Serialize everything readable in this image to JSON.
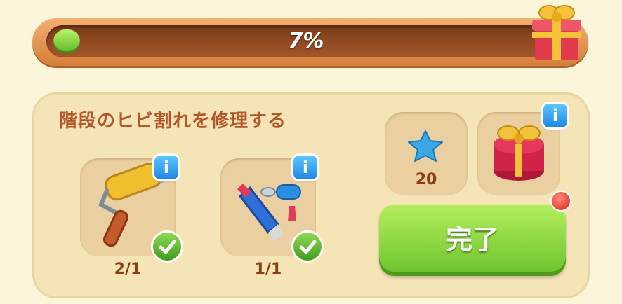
{
  "progress": {
    "label": "7%",
    "value": 0.07
  },
  "task": {
    "title": "階段のヒビ割れを修理する"
  },
  "items": [
    {
      "icon": "paint-roller-icon",
      "count": "2/1",
      "completed": true
    },
    {
      "icon": "glue-tube-icon",
      "count": "1/1",
      "completed": true
    }
  ],
  "rewards": {
    "stars": {
      "icon": "blue-star-icon",
      "amount": "20"
    },
    "gift": {
      "icon": "gift-box-icon"
    }
  },
  "info_label": "i",
  "complete_button": {
    "label": "完了"
  },
  "colors": {
    "accent_green": "#6cc22c",
    "title_brown": "#b5562a",
    "info_blue": "#1f86e6",
    "notification_red": "#e0201a"
  }
}
